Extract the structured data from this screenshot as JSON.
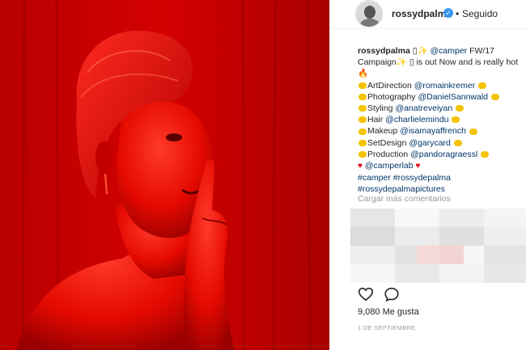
{
  "header": {
    "username": "rossydpalma",
    "separator": "•",
    "follow_status": "Seguido"
  },
  "caption": {
    "username": "rossydpalma",
    "line1_camper": "@camper",
    "line1_rest": " FW/17",
    "line2_a": "Campaign",
    "line2_b": " is out Now and is really hot",
    "credits": [
      {
        "role": "ArtDirection ",
        "handle": "@romainkremer"
      },
      {
        "role": "Photography ",
        "handle": "@DanielSannwald"
      },
      {
        "role": "Styling ",
        "handle": "@anatreveiyan"
      },
      {
        "role": "Hair ",
        "handle": "@charlielemindu"
      },
      {
        "role": "Makeup ",
        "handle": "@isamayaffrench"
      },
      {
        "role": "SetDesign ",
        "handle": "@garycard"
      },
      {
        "role": "Production ",
        "handle": "@pandoragraessl"
      }
    ],
    "camperlab": "@camperlab",
    "hashtags_1": "#camper #rossydepalma",
    "hashtags_2": "#rossydepalmapictures"
  },
  "comments": {
    "load_more": "Cargar más comentarios"
  },
  "footer": {
    "likes": "9,080 Me gusta",
    "date": "1 DE SEPTIEMBRE"
  },
  "icons": {
    "like": "heart-outline-icon",
    "comment": "speech-bubble-icon",
    "verified": "verified-badge-icon"
  },
  "colors": {
    "photo_red": "#c90000",
    "link_blue": "#003569",
    "verified_blue": "#3897f0"
  }
}
